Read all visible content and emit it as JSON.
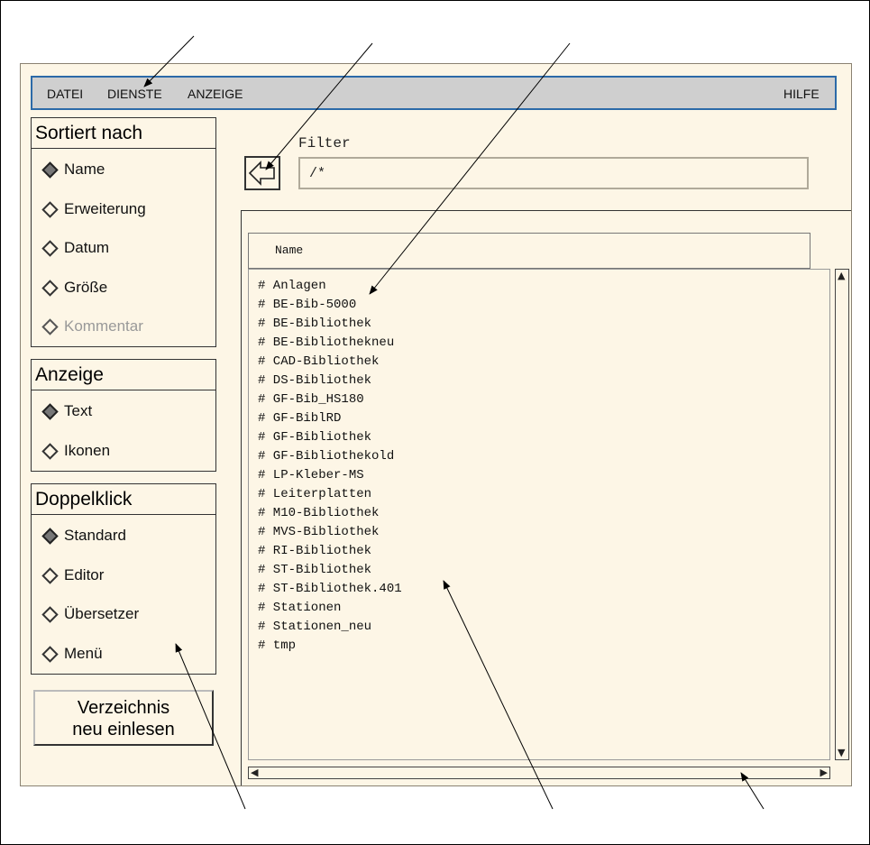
{
  "menubar": {
    "datei": "DATEI",
    "dienste": "DIENSTE",
    "anzeige": "ANZEIGE",
    "hilfe": "HILFE"
  },
  "sort": {
    "title": "Sortiert nach",
    "options": [
      {
        "label": "Name",
        "selected": true
      },
      {
        "label": "Erweiterung",
        "selected": false
      },
      {
        "label": "Datum",
        "selected": false
      },
      {
        "label": "Größe",
        "selected": false
      },
      {
        "label": "Kommentar",
        "selected": false,
        "disabled": true
      }
    ]
  },
  "view": {
    "title": "Anzeige",
    "options": [
      {
        "label": "Text",
        "selected": true
      },
      {
        "label": "Ikonen",
        "selected": false
      }
    ]
  },
  "doubleclick": {
    "title": "Doppelklick",
    "options": [
      {
        "label": "Standard",
        "selected": true
      },
      {
        "label": "Editor",
        "selected": false
      },
      {
        "label": "Übersetzer",
        "selected": false
      },
      {
        "label": "Menü",
        "selected": false
      }
    ]
  },
  "reload": {
    "line1": "Verzeichnis",
    "line2": "neu einlesen"
  },
  "filter": {
    "label": "Filter",
    "value": "/*"
  },
  "list": {
    "column": "Name",
    "items": [
      "# Anlagen",
      "# BE-Bib-5000",
      "# BE-Bibliothek",
      "# BE-Bibliothekneu",
      "# CAD-Bibliothek",
      "# DS-Bibliothek",
      "# GF-Bib_HS180",
      "# GF-BiblRD",
      "# GF-Bibliothek",
      "# GF-Bibliothekold",
      "# LP-Kleber-MS",
      "# Leiterplatten",
      "# M10-Bibliothek",
      "# MVS-Bibliothek",
      "# RI-Bibliothek",
      "# ST-Bibliothek",
      "# ST-Bibliothek.401",
      "# Stationen",
      "# Stationen_neu",
      "# tmp"
    ]
  },
  "icons": {
    "back": "back-arrow-icon",
    "radio": "diamond-radio-icon"
  }
}
